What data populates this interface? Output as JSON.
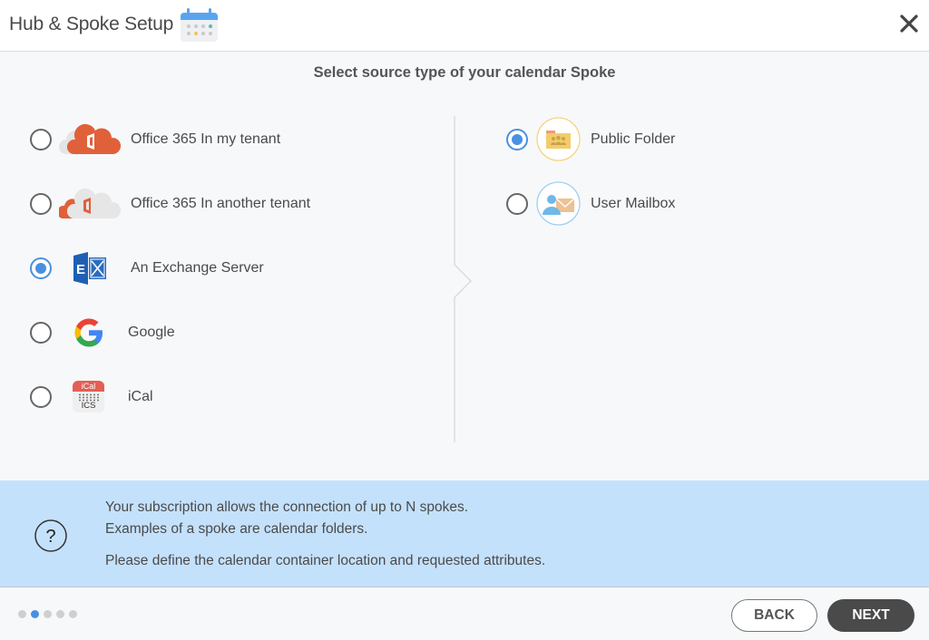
{
  "header": {
    "title": "Hub & Spoke Setup",
    "icon": "calendar-icon",
    "close_icon": "close-icon"
  },
  "main": {
    "heading": "Select source type of your calendar Spoke",
    "source_options": [
      {
        "label": "Office 365 In my tenant",
        "icon": "office365-cloud-icon",
        "selected": false
      },
      {
        "label": "Office 365 In another tenant",
        "icon": "office365-other-tenant-icon",
        "selected": false
      },
      {
        "label": "An Exchange Server",
        "icon": "exchange-icon",
        "selected": true
      },
      {
        "label": "Google",
        "icon": "google-icon",
        "selected": false
      },
      {
        "label": "iCal",
        "icon": "ical-icon",
        "selected": false
      }
    ],
    "container_options": [
      {
        "label": "Public Folder",
        "icon": "public-folder-icon",
        "selected": true
      },
      {
        "label": "User Mailbox",
        "icon": "user-mailbox-icon",
        "selected": false
      }
    ],
    "ical_icon_text": {
      "top": "iCal",
      "bottom": "ICS"
    }
  },
  "info": {
    "icon": "help-icon",
    "lines": [
      "Your subscription allows the connection of up to N spokes.",
      "Examples of a spoke are calendar folders.",
      "Please define the calendar container location and requested attributes."
    ]
  },
  "footer": {
    "steps_total": 5,
    "current_step": 2,
    "back_label": "BACK",
    "next_label": "NEXT"
  },
  "colors": {
    "accent": "#4a90e2",
    "info_background": "#c4e1fb",
    "office_orange": "#e0603a",
    "exchange_blue": "#1f5fb3",
    "next_button": "#4a4a4a"
  }
}
